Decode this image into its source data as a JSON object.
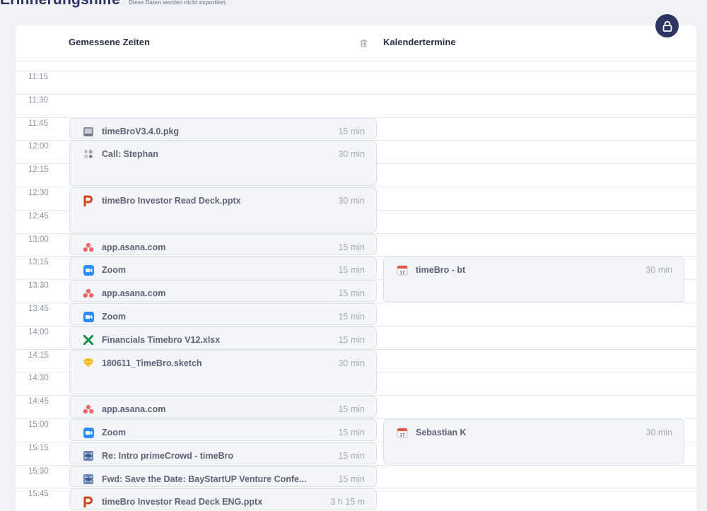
{
  "header": {
    "title": "Erinnerungshilfe",
    "subtitle": "Diese Daten werden nicht exportiert."
  },
  "columns": {
    "measured": "Gemessene Zeiten",
    "calendar": "Kalendertermine"
  },
  "times": [
    "11:15",
    "11:30",
    "11:45",
    "12:00",
    "12:15",
    "12:30",
    "12:45",
    "13:00",
    "13:15",
    "13:30",
    "13:45",
    "14:00",
    "14:15",
    "14:30",
    "14:45",
    "15:00",
    "15:15",
    "15:30",
    "15:45"
  ],
  "measured_events": [
    {
      "name": "timeBroV3.4.0.pkg",
      "duration": "15 min",
      "icon": "package-icon"
    },
    {
      "name": "Call: Stephan",
      "duration": "30 min",
      "icon": "facetime-icon"
    },
    {
      "name": "timeBro Investor Read Deck.pptx",
      "duration": "30 min",
      "icon": "powerpoint-icon"
    },
    {
      "name": "app.asana.com",
      "duration": "15 min",
      "icon": "asana-icon"
    },
    {
      "name": "Zoom",
      "duration": "15 min",
      "icon": "zoom-icon"
    },
    {
      "name": "app.asana.com",
      "duration": "15 min",
      "icon": "asana-icon"
    },
    {
      "name": "Zoom",
      "duration": "15 min",
      "icon": "zoom-icon"
    },
    {
      "name": "Financials Timebro V12.xlsx",
      "duration": "15 min",
      "icon": "excel-icon"
    },
    {
      "name": "180611_TimeBro.sketch",
      "duration": "30 min",
      "icon": "sketch-icon"
    },
    {
      "name": "app.asana.com",
      "duration": "15 min",
      "icon": "asana-icon"
    },
    {
      "name": "Zoom",
      "duration": "15 min",
      "icon": "zoom-icon"
    },
    {
      "name": "Re: Intro primeCrowd - timeBro",
      "duration": "15 min",
      "icon": "mail-icon"
    },
    {
      "name": "Fwd: Save the Date: BayStartUP Venture Confe...",
      "duration": "15 min",
      "icon": "mail-icon"
    },
    {
      "name": "timeBro Investor Read Deck ENG.pptx",
      "duration": "3 h 15 m",
      "icon": "powerpoint-icon"
    }
  ],
  "calendar_events": [
    {
      "name": "timeBro - bt",
      "duration": "30 min",
      "icon": "calendar-icon"
    },
    {
      "name": "Sebastian K",
      "duration": "30 min",
      "icon": "calendar-icon"
    }
  ],
  "colors": {
    "header_title": "#2a3260",
    "lock_button": "#2d3561",
    "asana": "#f06a6a",
    "zoom": "#2d8cff",
    "excel": "#1d8f4a",
    "powerpoint": "#d0421b",
    "sketch": "#f7b500",
    "calendar": "#e05a4f"
  }
}
